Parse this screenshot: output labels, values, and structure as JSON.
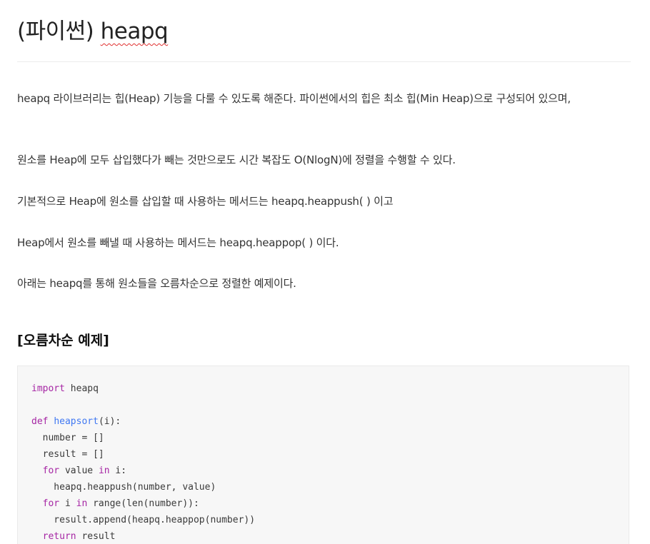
{
  "title": {
    "prefix": "(파이썬) ",
    "word": "heapq"
  },
  "paragraphs": [
    "heapq 라이브러리는 힙(Heap) 기능을 다룰 수 있도록 해준다. 파이썬에서의 힙은 최소 힙(Min Heap)으로 구성되어 있으며,",
    "원소를 Heap에 모두 삽입했다가 빼는 것만으로도 시간 복잡도 O(NlogN)에 정렬을 수행할 수 있다.",
    "기본적으로 Heap에 원소를 삽입할 때 사용하는 메서드는 heapq.heappush( ) 이고",
    "Heap에서 원소를 빼낼 때 사용하는 메서드는 heapq.heappop( ) 이다.",
    "아래는 heapq를 통해 원소들을 오름차순으로 정렬한 예제이다."
  ],
  "section_heading": "[오름차순 예제]",
  "code": {
    "l1_kw": "import",
    "l1_rest": " heapq",
    "l3_kw": "def",
    "l3_fn": "heapsort",
    "l3_rest": "(i):",
    "l4": "  number = []",
    "l5": "  result = []",
    "l6_indent": "  ",
    "l6_kw1": "for",
    "l6_mid": " value ",
    "l6_kw2": "in",
    "l6_rest": " i:",
    "l7": "    heapq.heappush(number, value)",
    "l8_indent": "  ",
    "l8_kw1": "for",
    "l8_mid": " i ",
    "l8_kw2": "in",
    "l8_rest": " range(len(number)):",
    "l9": "    result.append(heapq.heappop(number))",
    "l10_indent": "  ",
    "l10_kw": "return",
    "l10_rest": " result"
  },
  "colors": {
    "keyword": "#a626a4",
    "function_name": "#4078f2",
    "spellcheck_underline": "#e0302f"
  }
}
